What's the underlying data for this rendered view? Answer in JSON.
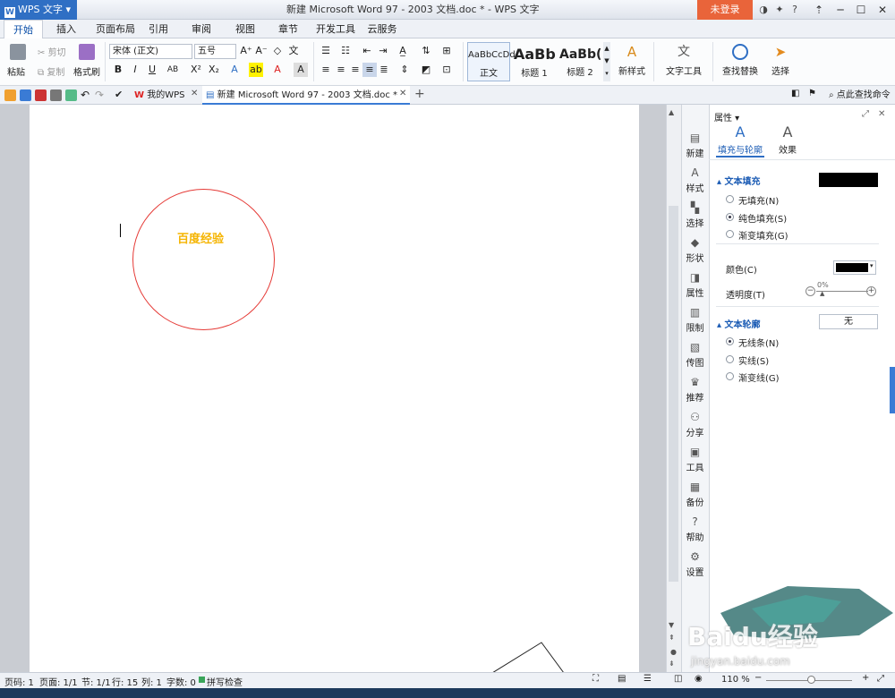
{
  "app": {
    "name": "WPS 文字",
    "window_title": "新建 Microsoft Word 97 - 2003 文档.doc * - WPS 文字",
    "login": "未登录"
  },
  "menu": {
    "tabs": [
      "开始",
      "插入",
      "页面布局",
      "引用",
      "审阅",
      "视图",
      "章节",
      "开发工具",
      "云服务"
    ]
  },
  "ribbon": {
    "paste": "粘贴",
    "cut": "剪切",
    "copy": "复制",
    "format_painter": "格式刷",
    "font_name": "宋体 (正文)",
    "font_size": "五号",
    "styles": [
      {
        "preview": "AaBbCcDd",
        "label": "正文"
      },
      {
        "preview": "AaBb",
        "label": "标题 1"
      },
      {
        "preview": "AaBb(",
        "label": "标题 2"
      }
    ],
    "new_style": "新样式",
    "text_tools": "文字工具",
    "find_replace": "查找替换",
    "select": "选择"
  },
  "quickbar": {
    "tabs": [
      {
        "label": "我的WPS"
      },
      {
        "label": "新建 Microsoft Word 97 - 2003 文档.doc *"
      }
    ],
    "search": "点此查找命令"
  },
  "document": {
    "circle_text": "百度经验",
    "circle_text_color": "#f5b400",
    "circle_color": "#e53935"
  },
  "sidebar": {
    "items": [
      {
        "icon": "new-icon",
        "label": "新建"
      },
      {
        "icon": "style-icon",
        "label": "样式"
      },
      {
        "icon": "select-icon",
        "label": "选择"
      },
      {
        "icon": "shape-icon",
        "label": "形状"
      },
      {
        "icon": "properties-icon",
        "label": "属性"
      },
      {
        "icon": "restrict-icon",
        "label": "限制"
      },
      {
        "icon": "transfer-icon",
        "label": "传图"
      },
      {
        "icon": "recommend-icon",
        "label": "推荐"
      },
      {
        "icon": "share-icon",
        "label": "分享"
      },
      {
        "icon": "tools-icon",
        "label": "工具"
      },
      {
        "icon": "backup-icon",
        "label": "备份"
      },
      {
        "icon": "help-icon",
        "label": "帮助"
      },
      {
        "icon": "settings-icon",
        "label": "设置"
      }
    ]
  },
  "properties": {
    "title": "属性",
    "tab_fill": "填充与轮廓",
    "tab_effect": "效果",
    "text_fill": "文本填充",
    "fill_options": [
      "无填充(N)",
      "纯色填充(S)",
      "渐变填充(G)"
    ],
    "color_label": "颜色(C)",
    "transparency_label": "透明度(T)",
    "transparency_value": "0%",
    "text_outline": "文本轮廓",
    "outline_value": "无",
    "outline_options": [
      "无线条(N)",
      "实线(S)",
      "渐变线(G)"
    ]
  },
  "status": {
    "page": "页码: 1",
    "pages": "页面: 1/1",
    "section": "节: 1/1",
    "row": "行: 15",
    "col": "列: 1",
    "words": "字数: 0",
    "spell": "拼写检查",
    "zoom": "110 %"
  },
  "watermark": {
    "brand": "Baidu经验",
    "url": "jingyan.baidu.com"
  }
}
